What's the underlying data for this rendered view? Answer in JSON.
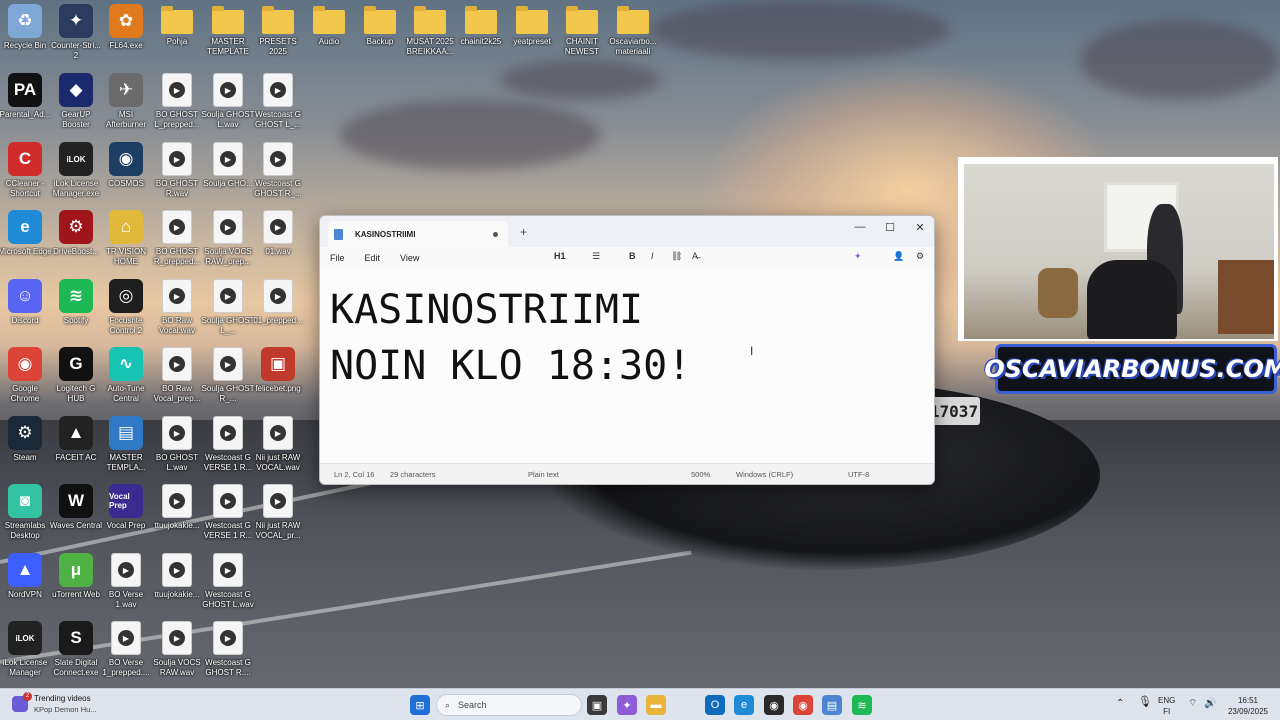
{
  "desktop": {
    "icons": [
      {
        "label": "Recycle Bin",
        "icon": "recycle-bin-icon",
        "color": "#7fa7d6",
        "glyph": "♻"
      },
      {
        "label": "Counter-Stri... 2",
        "icon": "counter-strike-icon",
        "color": "#2b3c5e",
        "glyph": "✦"
      },
      {
        "label": "FL64.exe",
        "icon": "fl-studio-icon",
        "color": "#e17a1d",
        "glyph": "✿"
      },
      {
        "label": "Pohja",
        "icon": "folder-icon",
        "type": "folder"
      },
      {
        "label": "MASTER TEMPLATE",
        "icon": "folder-icon",
        "type": "folder"
      },
      {
        "label": "PRESETS 2025",
        "icon": "folder-icon",
        "type": "folder"
      },
      {
        "label": "Audio",
        "icon": "folder-icon",
        "type": "folder"
      },
      {
        "label": "Backup",
        "icon": "folder-icon",
        "type": "folder"
      },
      {
        "label": "MUSAT 2025 BREIKKAA...",
        "icon": "folder-icon",
        "type": "folder"
      },
      {
        "label": "chainit2k25",
        "icon": "folder-icon",
        "type": "folder"
      },
      {
        "label": "yeatpreset",
        "icon": "folder-icon",
        "type": "folder"
      },
      {
        "label": "CHAINIT NEWEST",
        "icon": "folder-icon",
        "type": "folder"
      },
      {
        "label": "Oscaviarbo... materiaali",
        "icon": "folder-icon",
        "type": "folder"
      },
      {
        "label": "Parental_Ad...",
        "icon": "parental-advisory-icon",
        "color": "#111111",
        "glyph": "PA"
      },
      {
        "label": "GearUP Booster",
        "icon": "gearup-icon",
        "color": "#1b2a6b",
        "glyph": "◆"
      },
      {
        "label": "MSI Afterburner",
        "icon": "msi-afterburner-icon",
        "color": "#6b6b6b",
        "glyph": "✈"
      },
      {
        "label": "BO GHOST L_prepped...",
        "icon": "audio-file-icon",
        "type": "media"
      },
      {
        "label": "Soulja GHOST L.wav",
        "icon": "audio-file-icon",
        "type": "media"
      },
      {
        "label": "Westcoast G GHOST L_...",
        "icon": "audio-file-icon",
        "type": "media"
      },
      {
        "label": "CCleaner - Shortcut",
        "icon": "ccleaner-icon",
        "color": "#d02c2c",
        "glyph": "C"
      },
      {
        "label": "iLok License Manager.exe",
        "icon": "ilok-icon",
        "color": "#222222",
        "glyph": "iLOK"
      },
      {
        "label": "COSMOS",
        "icon": "cosmos-icon",
        "color": "#1d3d63",
        "glyph": "◉"
      },
      {
        "label": "BO GHOST R.wav",
        "icon": "audio-file-icon",
        "type": "media"
      },
      {
        "label": "Soulja GHO...",
        "icon": "audio-file-icon",
        "type": "media"
      },
      {
        "label": "Westcoast G GHOST R_...",
        "icon": "audio-file-icon",
        "type": "media"
      },
      {
        "label": "Microsoft Edge",
        "icon": "edge-icon",
        "color": "#1f8ad6",
        "glyph": "e"
      },
      {
        "label": "DriveBoost...",
        "icon": "driveboost-icon",
        "color": "#a0141c",
        "glyph": "⚙"
      },
      {
        "label": "TR VISION HOME",
        "icon": "tr-vision-icon",
        "color": "#e0b93a",
        "glyph": "⌂"
      },
      {
        "label": "BO GHOST R_prepped...",
        "icon": "audio-file-icon",
        "type": "media"
      },
      {
        "label": "Soulja VOCS RAW_prep...",
        "icon": "audio-file-icon",
        "type": "media"
      },
      {
        "label": "01.wav",
        "icon": "audio-file-icon",
        "type": "media"
      },
      {
        "label": "Discord",
        "icon": "discord-icon",
        "color": "#5865f2",
        "glyph": "☺"
      },
      {
        "label": "Spotify",
        "icon": "spotify-icon",
        "color": "#1db954",
        "glyph": "≋"
      },
      {
        "label": "Focusrite Control 2",
        "icon": "focusrite-icon",
        "color": "#1e1e1e",
        "glyph": "◎"
      },
      {
        "label": "BO Raw Vocal.wav",
        "icon": "audio-file-icon",
        "type": "media"
      },
      {
        "label": "Soulja GHOST L_...",
        "icon": "audio-file-icon",
        "type": "media"
      },
      {
        "label": "01_prepped...",
        "icon": "audio-file-icon",
        "type": "media"
      },
      {
        "label": "Google Chrome",
        "icon": "chrome-icon",
        "color": "#db4437",
        "glyph": "◉"
      },
      {
        "label": "Logitech G HUB",
        "icon": "logitech-icon",
        "color": "#111111",
        "glyph": "G"
      },
      {
        "label": "Auto-Tune Central",
        "icon": "auto-tune-icon",
        "color": "#17c3b2",
        "glyph": "∿"
      },
      {
        "label": "BO Raw Vocal_prep...",
        "icon": "audio-file-icon",
        "type": "media"
      },
      {
        "label": "Soulja GHOST R_...",
        "icon": "audio-file-icon",
        "type": "media"
      },
      {
        "label": "felicebet.png",
        "icon": "image-file-icon",
        "color": "#c0392b",
        "glyph": "▣"
      },
      {
        "label": "Steam",
        "icon": "steam-icon",
        "color": "#1b2838",
        "glyph": "⚙"
      },
      {
        "label": "FACEIT AC",
        "icon": "faceit-icon",
        "color": "#222222",
        "glyph": "▲"
      },
      {
        "label": "MASTER TEMPLA...",
        "icon": "template-file-icon",
        "color": "#2f79c7",
        "glyph": "▤"
      },
      {
        "label": "BO GHOST L.wav",
        "icon": "audio-file-icon",
        "type": "media"
      },
      {
        "label": "Westcoast G VERSE 1 R...",
        "icon": "audio-file-icon",
        "type": "media"
      },
      {
        "label": "Nii just RAW VOCAL.wav",
        "icon": "audio-file-icon",
        "type": "media"
      },
      {
        "label": "Streamlabs Desktop",
        "icon": "streamlabs-icon",
        "color": "#31c3a2",
        "glyph": "◙"
      },
      {
        "label": "Waves Central",
        "icon": "waves-icon",
        "color": "#111111",
        "glyph": "W"
      },
      {
        "label": "Vocal Prep",
        "icon": "vocal-prep-icon",
        "color": "#3b2a8f",
        "glyph": "Vocal Prep"
      },
      {
        "label": "ttuujokakie...",
        "icon": "audio-file-icon",
        "type": "media"
      },
      {
        "label": "Westcoast G VERSE 1 R...",
        "icon": "audio-file-icon",
        "type": "media"
      },
      {
        "label": "Nii just RAW VOCAL_pr...",
        "icon": "audio-file-icon",
        "type": "media"
      },
      {
        "label": "NordVPN",
        "icon": "nordvpn-icon",
        "color": "#3e5fff",
        "glyph": "▲"
      },
      {
        "label": "uTorrent Web",
        "icon": "utorrent-icon",
        "color": "#4fb043",
        "glyph": "μ"
      },
      {
        "label": "BO Verse 1.wav",
        "icon": "audio-file-icon",
        "type": "media"
      },
      {
        "label": "ttuujokakie...",
        "icon": "audio-file-icon",
        "type": "media"
      },
      {
        "label": "Westcoast G GHOST L.wav",
        "icon": "audio-file-icon",
        "type": "media"
      },
      {
        "label": "iLok License Manager",
        "icon": "ilok-icon",
        "color": "#222222",
        "glyph": "iLOK"
      },
      {
        "label": "Slate Digital Connect.exe",
        "icon": "slate-digital-icon",
        "color": "#1a1a1a",
        "glyph": "S"
      },
      {
        "label": "BO Verse 1_prepped....",
        "icon": "audio-file-icon",
        "type": "media"
      },
      {
        "label": "Soulja VOCS RAW.wav",
        "icon": "audio-file-icon",
        "type": "media"
      },
      {
        "label": "Westcoast G GHOST R....",
        "icon": "audio-file-icon",
        "type": "media"
      }
    ]
  },
  "notepad": {
    "tab_title": "KASINOSTRIIMI",
    "new_tab_glyph": "+",
    "controls": {
      "minimize": "—",
      "maximize": "☐",
      "close": "✕"
    },
    "menu": [
      "File",
      "Edit",
      "View"
    ],
    "toolbar": {
      "heading": "H1",
      "list_glyph": "☰",
      "bold": "B",
      "italic": "I",
      "link": "⛓",
      "clear": "A̶",
      "copilot": "✦",
      "account": "👤",
      "settings": "⚙"
    },
    "content": "KASINOSTRIIMI\nNOIN KLO 18:30!",
    "status": {
      "position": "Ln 2, Col 16",
      "characters": "29 characters",
      "format": "Plain text",
      "zoom": "500%",
      "line_ending": "Windows (CRLF)",
      "encoding": "UTF-8"
    }
  },
  "overlay": {
    "banner_text": "OSCAVIARBONUS.COM",
    "banner_color": "#3c5fd6"
  },
  "wallpaper": {
    "plate_text": "17037"
  },
  "taskbar": {
    "widget_title": "Trending videos",
    "widget_subtitle": "KPop Demon Hu...",
    "widget_badge": "2",
    "search_placeholder": "Search",
    "language": "ENG",
    "region": "FI",
    "time": "16:51",
    "date": "23/09/2025",
    "pinned": [
      {
        "icon": "start-icon",
        "color": "#1f6fd6",
        "glyph": "⊞"
      },
      {
        "icon": "task-view-icon",
        "color": "#3a3a3a",
        "glyph": "▣"
      },
      {
        "icon": "copilot-icon",
        "color": "#8f5bd6",
        "glyph": "✦"
      },
      {
        "icon": "file-explorer-icon",
        "color": "#e8b43a",
        "glyph": "▬"
      },
      {
        "icon": "outlook-icon",
        "color": "#0f6cbd",
        "glyph": "O"
      },
      {
        "icon": "edge-icon",
        "color": "#1f8ad6",
        "glyph": "e"
      },
      {
        "icon": "camo-icon",
        "color": "#2a2a2a",
        "glyph": "◉"
      },
      {
        "icon": "chrome-icon",
        "color": "#db4437",
        "glyph": "◉"
      },
      {
        "icon": "notepad-icon",
        "color": "#4c86d2",
        "glyph": "▤"
      },
      {
        "icon": "spotify-icon",
        "color": "#1db954",
        "glyph": "≋"
      }
    ]
  }
}
